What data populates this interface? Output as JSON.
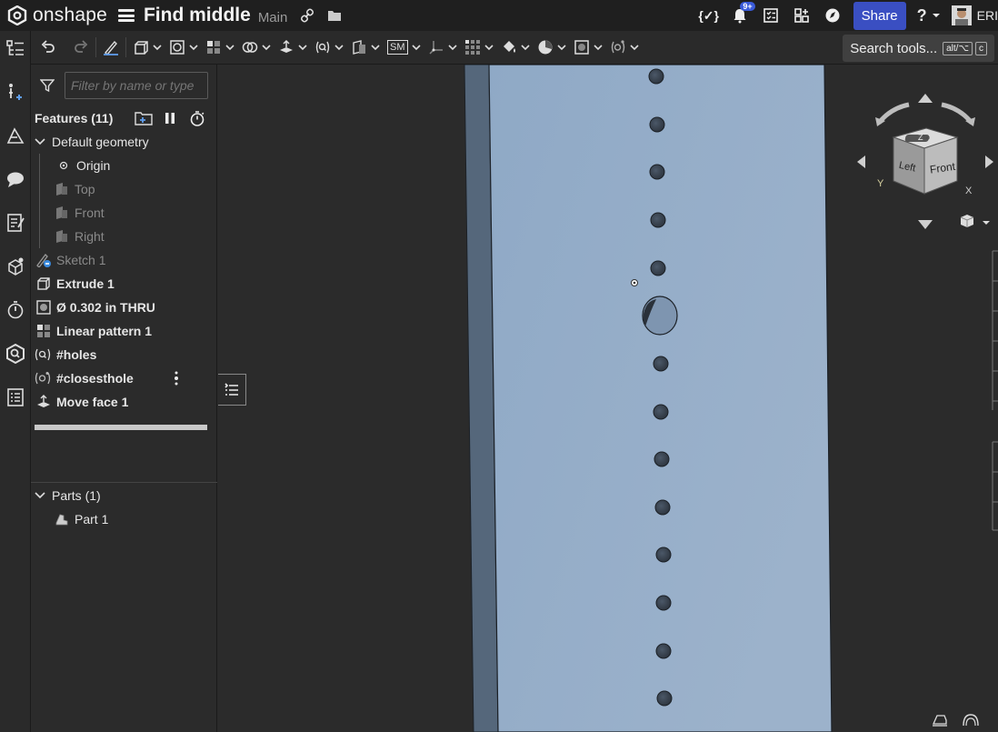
{
  "app": {
    "brand": "onshape",
    "document_title": "Find middle",
    "branch": "Main"
  },
  "topbar": {
    "notifications_badge": "9+",
    "share_label": "Share",
    "help_label": "?",
    "user_name": "ERI"
  },
  "toolbar": {
    "sm_label": "SM",
    "search_tools_label": "Search tools...",
    "kbd_1": "alt/⌥",
    "kbd_2": "c"
  },
  "feature_panel": {
    "filter_placeholder": "Filter by name or type",
    "features_header": "Features (11)",
    "default_geometry": "Default geometry",
    "origin": "Origin",
    "top": "Top",
    "front": "Front",
    "right": "Right",
    "sketch1": "Sketch 1",
    "extrude1": "Extrude 1",
    "hole": "Ø 0.302 in THRU",
    "linear_pattern": "Linear pattern 1",
    "holes_var": "#holes",
    "closest_hole": "#closesthole",
    "move_face": "Move face 1",
    "parts_header": "Parts (1)",
    "part1": "Part 1"
  },
  "viewcube": {
    "face_left": "Left",
    "face_front": "Front",
    "face_top": "Top",
    "axis_x": "X",
    "axis_y": "Y",
    "axis_z": "Z"
  },
  "colors": {
    "part_face": "#97aec8",
    "part_side": "#55677b",
    "accent": "#3a4fc2",
    "background": "#2b2b2b"
  }
}
